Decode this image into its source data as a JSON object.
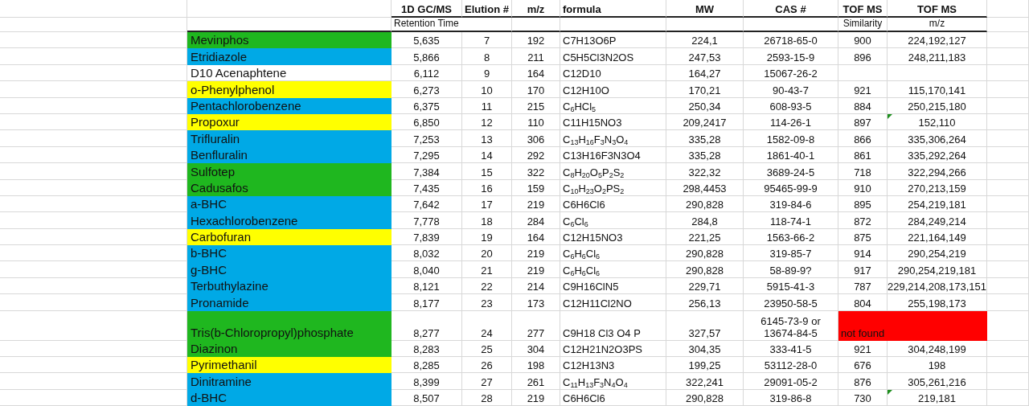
{
  "columns": [
    {
      "title": "1D GC/MS",
      "subtitle": "Retention Time"
    },
    {
      "title": "Elution #"
    },
    {
      "title": "m/z"
    },
    {
      "title": "formula"
    },
    {
      "title": "MW"
    },
    {
      "title": "CAS #"
    },
    {
      "title": "TOF MS",
      "subtitle": "Similarity"
    },
    {
      "title": "TOF MS",
      "subtitle": "m/z"
    }
  ],
  "rows": [
    {
      "name": "Mevinphos",
      "color": "#1fb71f",
      "rt": "5,635",
      "elution": "7",
      "mz": "192",
      "formula": "C7H13O6P",
      "mw": "224,1",
      "cas": "26718-65-0",
      "similarity": "900",
      "tof_mz": "224,192,127",
      "comment": false
    },
    {
      "name": "Etridiazole",
      "color": "#00a9e6",
      "rt": "5,866",
      "elution": "8",
      "mz": "211",
      "formula": "C5H5Cl3N2OS",
      "mw": "247,53",
      "cas": "2593-15-9",
      "similarity": "896",
      "tof_mz": "248,211,183",
      "comment": false
    },
    {
      "name": "D10 Acenaphtene",
      "color": "#ffffff",
      "rt": "6,112",
      "elution": "9",
      "mz": "164",
      "formula": "C12D10",
      "mw": "164,27",
      "cas": "15067-26-2",
      "comment": false
    },
    {
      "name": "o-Phenylphenol",
      "color": "#ffff00",
      "rt": "6,273",
      "elution": "10",
      "mz": "170",
      "formula": "C12H10O",
      "mw": "170,21",
      "cas": "90-43-7",
      "similarity": "921",
      "tof_mz": "115,170,141",
      "comment": false
    },
    {
      "name": "Pentachlorobenzene",
      "color": "#00a9e6",
      "rt": "6,375",
      "elution": "11",
      "mz": "215",
      "formula": "C$_{6}$HCl$_{5}$",
      "mw": "250,34",
      "cas": "608-93-5",
      "similarity": "884",
      "tof_mz": "250,215,180",
      "comment": false
    },
    {
      "name": "Propoxur",
      "color": "#ffff00",
      "rt": "6,850",
      "elution": "12",
      "mz": "110",
      "formula": "C11H15NO3",
      "mw": "209,2417",
      "cas": "114-26-1",
      "similarity": "897",
      "tof_mz": "152,110",
      "comment": true
    },
    {
      "name": "Trifluralin",
      "color": "#00a9e6",
      "rt": "7,253",
      "elution": "13",
      "mz": "306",
      "formula": "C$_{13}$H$_{16}$F$_{3}$N$_{3}$O$_{4}$",
      "mw": "335,28",
      "cas": "1582-09-8",
      "similarity": "866",
      "tof_mz": "335,306,264",
      "comment": false
    },
    {
      "name": "Benfluralin",
      "color": "#00a9e6",
      "rt": "7,295",
      "elution": "14",
      "mz": "292",
      "formula": "C13H16F3N3O4",
      "mw": "335,28",
      "cas": "1861-40-1",
      "similarity": "861",
      "tof_mz": "335,292,264",
      "comment": false
    },
    {
      "name": "Sulfotep",
      "color": "#1fb71f",
      "rt": "7,384",
      "elution": "15",
      "mz": "322",
      "formula": "C$_{8}$H$_{20}$O$_{5}$P$_{2}$S$_{2}$",
      "mw": "322,32",
      "cas": "3689-24-5",
      "similarity": "718",
      "tof_mz": "322,294,266",
      "comment": false
    },
    {
      "name": "Cadusafos",
      "color": "#1fb71f",
      "rt": "7,435",
      "elution": "16",
      "mz": "159",
      "formula": "C$_{10}$H$_{23}$O$_{2}$PS$_{2}$",
      "mw": "298,4453",
      "cas": "95465-99-9",
      "similarity": "910",
      "tof_mz": "270,213,159",
      "comment": false
    },
    {
      "name": "a-BHC",
      "color": "#00a9e6",
      "rt": "7,642",
      "elution": "17",
      "mz": "219",
      "formula": "C6H6Cl6",
      "mw": "290,828",
      "cas": "319-84-6",
      "similarity": "895",
      "tof_mz": "254,219,181",
      "comment": false
    },
    {
      "name": "Hexachlorobenzene",
      "color": "#00a9e6",
      "rt": "7,778",
      "elution": "18",
      "mz": "284",
      "formula": "C$_{6}$Cl$_{6}$",
      "mw": "284,8",
      "cas": "118-74-1",
      "similarity": "872",
      "tof_mz": "284,249,214",
      "comment": false
    },
    {
      "name": "Carbofuran",
      "color": "#ffff00",
      "rt": "7,839",
      "elution": "19",
      "mz": "164",
      "formula": "C12H15NO3",
      "mw": "221,25",
      "cas": "1563-66-2",
      "similarity": "875",
      "tof_mz": "221,164,149",
      "comment": false
    },
    {
      "name": "b-BHC",
      "color": "#00a9e6",
      "rt": "8,032",
      "elution": "20",
      "mz": "219",
      "formula": "C$_{6}$H$_{6}$Cl$_{6}$",
      "mw": "290,828",
      "cas": "319-85-7",
      "similarity": "914",
      "tof_mz": "290,254,219",
      "comment": false
    },
    {
      "name": "g-BHC",
      "color": "#00a9e6",
      "rt": "8,040",
      "elution": "21",
      "mz": "219",
      "formula": "C$_{6}$H$_{6}$Cl$_{6}$",
      "mw": "290,828",
      "cas": "58-89-9?",
      "similarity": "917",
      "tof_mz": "290,254,219,181",
      "comment": false
    },
    {
      "name": "Terbuthylazine",
      "color": "#00a9e6",
      "rt": "8,121",
      "elution": "22",
      "mz": "214",
      "formula": "C9H16ClN5",
      "mw": "229,71",
      "cas": "5915-41-3",
      "similarity": "787",
      "tof_mz": "229,214,208,173,151",
      "comment": false
    },
    {
      "name": "Pronamide",
      "color": "#00a9e6",
      "rt": "8,177",
      "elution": "23",
      "mz": "173",
      "formula": "C12H11Cl2NO",
      "mw": "256,13",
      "cas": "23950-58-5",
      "similarity": "804",
      "tof_mz": "255,198,173",
      "comment": false
    },
    {
      "name": "Tris(b-Chloropropyl)phosphate",
      "color": "#1fb71f",
      "rt": "8,277",
      "elution": "24",
      "mz": "277",
      "formula": "C9H18 Cl3 O4 P",
      "mw": "327,57",
      "cas": "6145-73-9 or 13674-84-5",
      "note": "not found",
      "comment": false
    },
    {
      "name": "Diazinon",
      "color": "#1fb71f",
      "rt": "8,283",
      "elution": "25",
      "mz": "304",
      "formula": "C12H21N2O3PS",
      "mw": "304,35",
      "cas": "333-41-5",
      "similarity": "921",
      "tof_mz": "304,248,199",
      "comment": false
    },
    {
      "name": "Pyrimethanil",
      "color": "#ffff00",
      "rt": "8,285",
      "elution": "26",
      "mz": "198",
      "formula": "C12H13N3",
      "mw": "199,25",
      "cas": "53112-28-0",
      "similarity": "676",
      "tof_mz": "198",
      "comment": false
    },
    {
      "name": "Dinitramine",
      "color": "#00a9e6",
      "rt": "8,399",
      "elution": "27",
      "mz": "261",
      "formula": "C$_{11}$H$_{13}$F$_{3}$N$_{4}$O$_{4}$",
      "mw": "322,241",
      "cas": "29091-05-2",
      "similarity": "876",
      "tof_mz": "305,261,216",
      "comment": false
    },
    {
      "name": "d-BHC",
      "color": "#00a9e6",
      "rt": "8,507",
      "elution": "28",
      "mz": "219",
      "formula": "C6H6Cl6",
      "mw": "290,828",
      "cas": "319-86-8",
      "similarity": "730",
      "tof_mz": "219,181",
      "comment": true
    }
  ]
}
